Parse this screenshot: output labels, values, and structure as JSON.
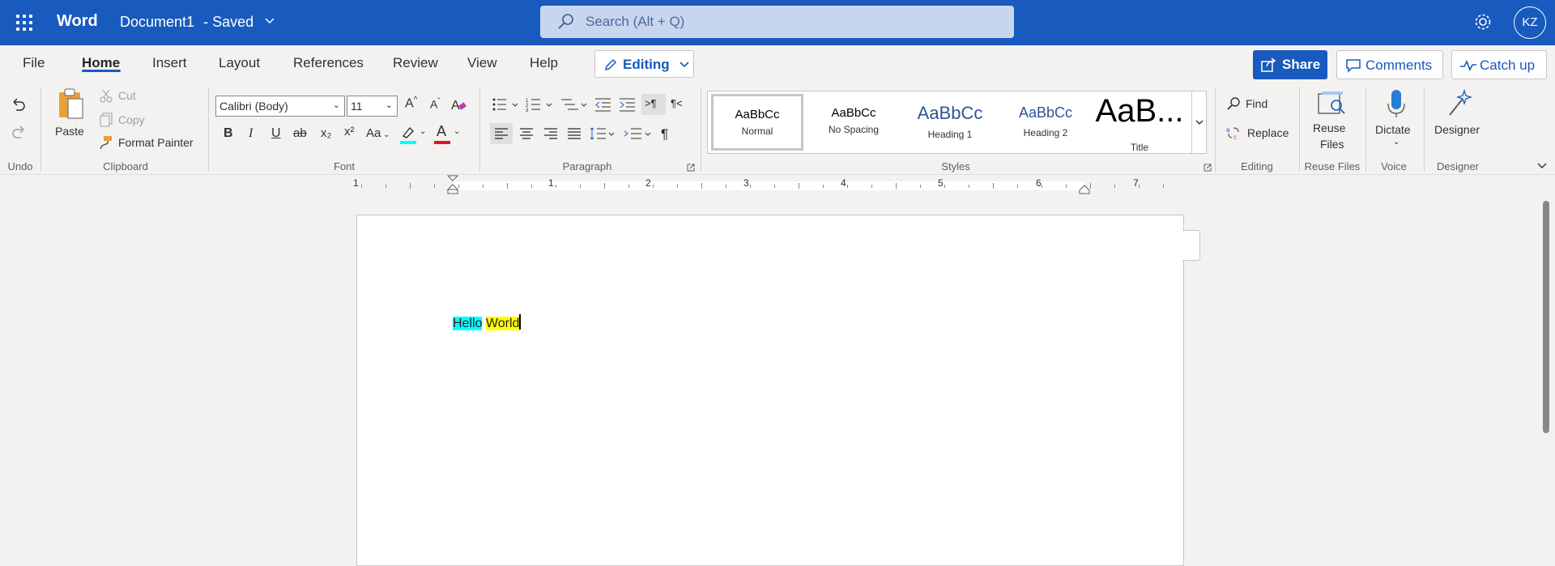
{
  "titlebar": {
    "app_name": "Word",
    "doc_title": "Document1",
    "save_status": "- Saved",
    "search_placeholder": "Search (Alt + Q)",
    "avatar_initials": "KZ",
    "bg_color": "#185abd"
  },
  "tabs": [
    {
      "label": "File"
    },
    {
      "label": "Home",
      "active": true
    },
    {
      "label": "Insert"
    },
    {
      "label": "Layout"
    },
    {
      "label": "References"
    },
    {
      "label": "Review"
    },
    {
      "label": "View"
    },
    {
      "label": "Help"
    }
  ],
  "mode_button": {
    "label": "Editing"
  },
  "actions": {
    "share": "Share",
    "comments": "Comments",
    "catchup": "Catch up"
  },
  "ribbon": {
    "undo_group": "Undo",
    "clipboard": {
      "label": "Clipboard",
      "paste": "Paste",
      "cut": "Cut",
      "copy": "Copy",
      "format_painter": "Format Painter"
    },
    "font": {
      "label": "Font",
      "font_name": "Calibri (Body)",
      "font_size": "11",
      "bold": "B",
      "italic": "I",
      "underline": "U",
      "strike": "ab",
      "subscript": "x₂",
      "superscript": "x²",
      "change_case": "Aa",
      "grow": "A^",
      "shrink": "Aˇ",
      "font_color": "A",
      "highlight_color": "#00ffff",
      "font_color_bar": "#e81123"
    },
    "paragraph": {
      "label": "Paragraph"
    },
    "styles": {
      "label": "Styles",
      "items": [
        {
          "preview": "AaBbCc",
          "name": "Normal"
        },
        {
          "preview": "AaBbCc",
          "name": "No Spacing"
        },
        {
          "preview": "AaBbCc",
          "name": "Heading 1"
        },
        {
          "preview": "AaBbCc",
          "name": "Heading 2"
        },
        {
          "preview": "AaB...",
          "name": "Title"
        }
      ]
    },
    "editing": {
      "label": "Editing",
      "find": "Find",
      "replace": "Replace"
    },
    "reuse_files": {
      "label": "Reuse Files",
      "button_line1": "Reuse",
      "button_line2": "Files"
    },
    "voice": {
      "label": "Voice",
      "dictate": "Dictate"
    },
    "designer": {
      "label": "Designer",
      "button": "Designer"
    }
  },
  "ruler": {
    "numbers": [
      "1",
      "1",
      "2",
      "3",
      "4",
      "5",
      "6",
      "7"
    ]
  },
  "document": {
    "word1": "Hello",
    "space": " ",
    "word2": "World",
    "word1_highlight": "#00ffff",
    "word2_highlight": "#ffff00"
  }
}
